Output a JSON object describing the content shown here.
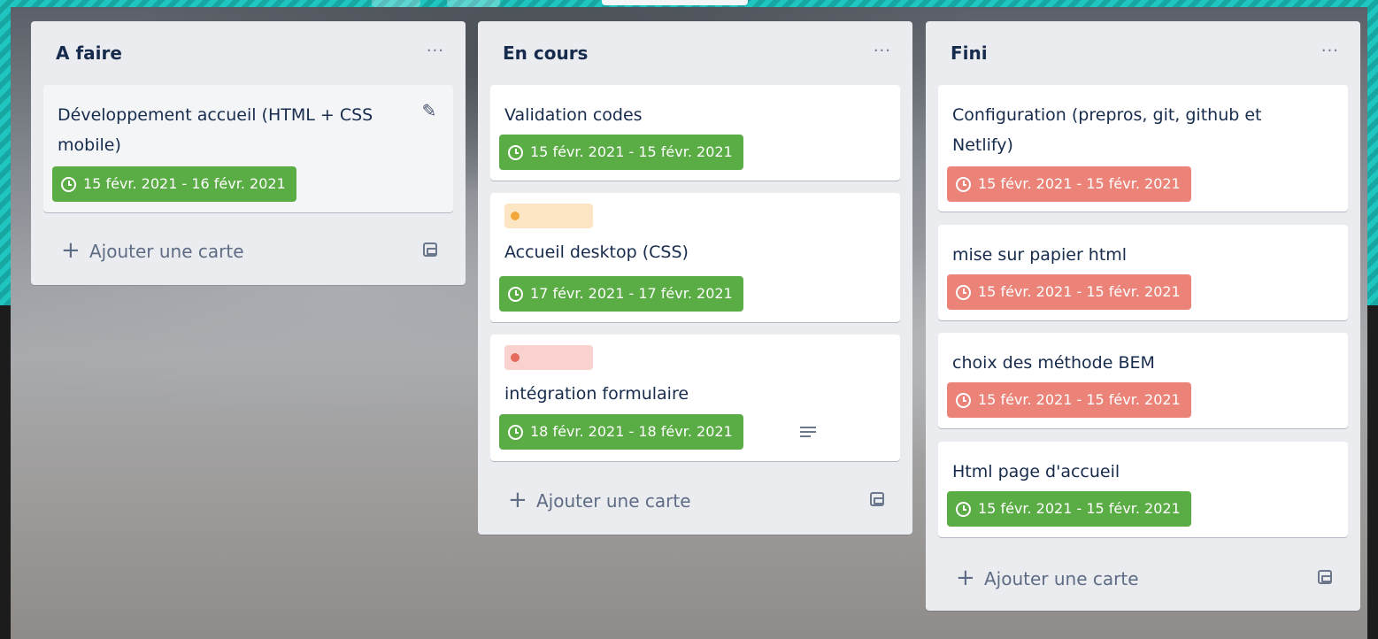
{
  "colors": {
    "due_green": "#5aac44",
    "due_red": "#eb8379",
    "label_orange_bg": "#fde6c4",
    "label_orange_dot": "#f2a73b",
    "label_red_bg": "#f9d2d0",
    "label_red_dot": "#e36a5d",
    "list_bg": "#ebecf0",
    "frame": "#1fc6c0"
  },
  "lists": [
    {
      "title": "A faire",
      "menu": "···",
      "cards": [
        {
          "title": "Développement accueil (HTML + CSS mobile)",
          "due": "15 févr. 2021 - 16 févr. 2021",
          "due_status": "green",
          "icon": "pencil-icon"
        }
      ],
      "add_card": "Ajouter une carte"
    },
    {
      "title": "En cours",
      "menu": "···",
      "cards": [
        {
          "title": "Validation codes",
          "due": "15 févr. 2021 - 15 févr. 2021",
          "due_status": "green"
        },
        {
          "label": "orange",
          "title": "Accueil desktop (CSS)",
          "due": "17 févr. 2021 - 17 févr. 2021",
          "due_status": "green"
        },
        {
          "label": "red",
          "title": "intégration formulaire",
          "due": "18 févr. 2021 - 18 févr. 2021",
          "due_status": "green",
          "icon": "description-icon"
        }
      ],
      "add_card": "Ajouter une carte"
    },
    {
      "title": "Fini",
      "menu": "···",
      "cards": [
        {
          "title": "Configuration (prepros, git, github et Netlify)",
          "due": "15 févr. 2021 - 15 févr. 2021",
          "due_status": "red"
        },
        {
          "title": "mise sur papier html",
          "due": "15 févr. 2021 - 15 févr. 2021",
          "due_status": "red"
        },
        {
          "title": "choix des méthode BEM",
          "due": "15 févr. 2021 - 15 févr. 2021",
          "due_status": "red"
        },
        {
          "title": "Html page d'accueil",
          "due": "15 févr. 2021 - 15 févr. 2021",
          "due_status": "green"
        }
      ],
      "add_card": "Ajouter une carte"
    }
  ]
}
